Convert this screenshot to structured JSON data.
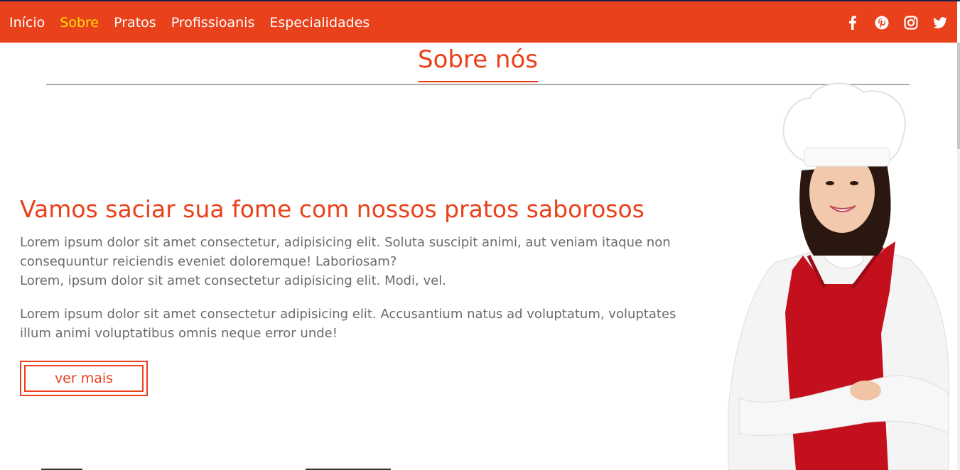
{
  "nav": {
    "links": [
      "Início",
      "Sobre",
      "Pratos",
      "Profissioanis",
      "Especialidades"
    ],
    "active_index": 1,
    "background": "#e8411b",
    "active_color": "#ffe000"
  },
  "social": [
    "facebook-icon",
    "pinterest-icon",
    "instagram-icon",
    "twitter-icon"
  ],
  "section": {
    "title": "Sobre nós"
  },
  "about": {
    "headline": "Vamos saciar sua fome com nossos pratos saborosos",
    "paragraph1": "Lorem ipsum dolor sit amet consectetur, adipisicing elit. Soluta suscipit animi, aut veniam itaque non consequuntur reiciendis eveniet doloremque! Laboriosam?",
    "paragraph1b": "Lorem, ipsum dolor sit amet consectetur adipisicing elit. Modi, vel.",
    "paragraph2": "Lorem ipsum dolor sit amet consectetur adipisicing elit. Accusantium natus ad voluptatum, voluptates illum animi voluptatibus omnis neque error unde!",
    "button": "ver mais"
  },
  "colors": {
    "accent": "#e8411b",
    "text": "#6b6b6b",
    "apron": "#c4101c"
  }
}
